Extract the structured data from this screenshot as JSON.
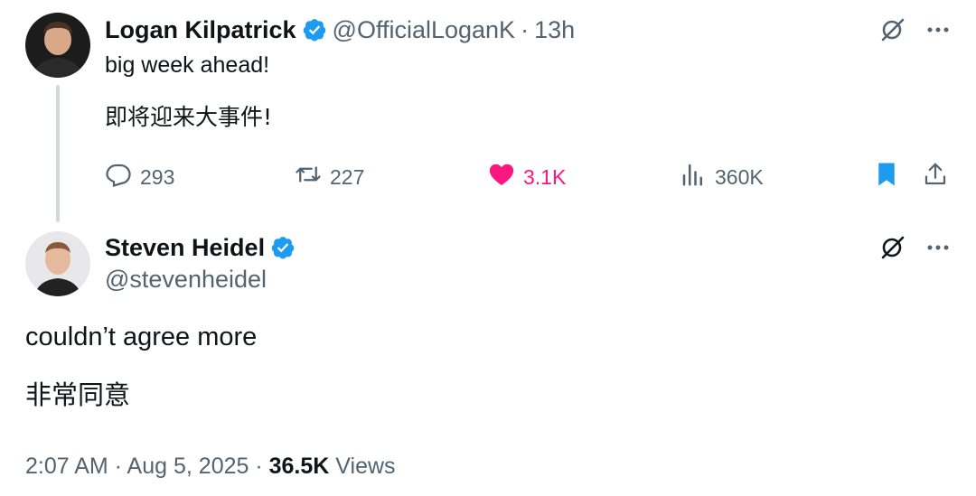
{
  "tweet1": {
    "name": "Logan Kilpatrick",
    "handle": "@OfficialLoganK",
    "separator": "·",
    "time": "13h",
    "text_line1": "big week ahead!",
    "text_line2": "即将迎来大事件!",
    "actions": {
      "replies": "293",
      "retweets": "227",
      "likes": "3.1K",
      "views": "360K"
    },
    "liked": true,
    "bookmarked": true
  },
  "tweet2": {
    "name": "Steven Heidel",
    "handle": "@stevenheidel",
    "text_line1": "couldn’t agree more",
    "text_line2": "非常同意",
    "timestamp": "2:07 AM · Aug 5, 2025 · ",
    "views_count": "36.5K",
    "views_label": " Views"
  },
  "colors": {
    "verified": "#1d9bf0",
    "like": "#f91880",
    "bookmark": "#1d9bf0",
    "muted": "#536471",
    "thread_line": "#cfd9de"
  },
  "icons": [
    "grok-icon",
    "more-icon",
    "reply-icon",
    "retweet-icon",
    "heart-icon",
    "analytics-icon",
    "bookmark-icon",
    "share-icon",
    "verified-badge-icon"
  ]
}
